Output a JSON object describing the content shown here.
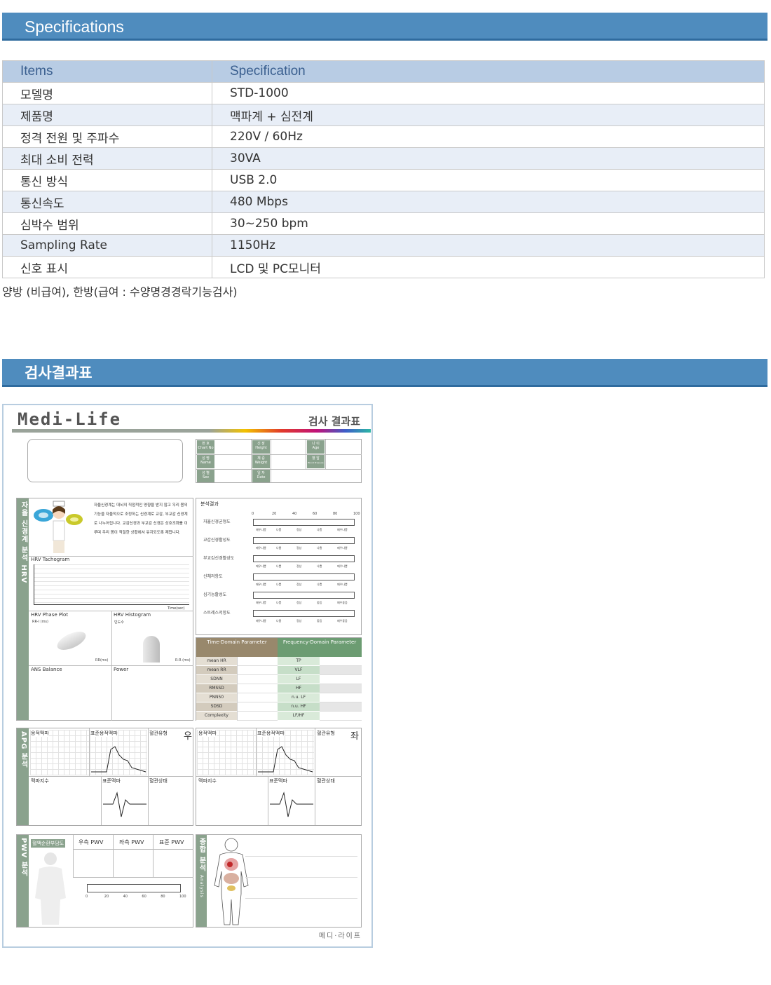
{
  "sections": {
    "specifications": "Specifications",
    "result_sheet": "검사결과표"
  },
  "spec_table": {
    "headers": [
      "Items",
      "Specification"
    ],
    "rows": [
      [
        "모델명",
        "STD-1000"
      ],
      [
        "제품명",
        "맥파계 + 심전계"
      ],
      [
        "정격 전원 및 주파수",
        "220V / 60Hz"
      ],
      [
        "최대 소비 전력",
        "30VA"
      ],
      [
        "통신 방식",
        "USB 2.0"
      ],
      [
        "통신속도",
        "480 Mbps"
      ],
      [
        "심박수 범위",
        "30~250 bpm"
      ],
      [
        "Sampling Rate",
        "1150Hz"
      ],
      [
        "신호 표시",
        "LCD 및 PC모니터"
      ]
    ],
    "note": "양방 (비급여), 한방(급여 : 수양명경경락기능검사)"
  },
  "sheet": {
    "logo": "Medi-Life",
    "title": "검사 결과표",
    "footer": "메디·라이프",
    "patient_info": [
      {
        "ko": "번 호",
        "en": "Chart No"
      },
      {
        "ko": "신 장",
        "en": "Height"
      },
      {
        "ko": "나 이",
        "en": "Age"
      },
      {
        "ko": "성 명",
        "en": "Name"
      },
      {
        "ko": "체 중",
        "en": "Weight"
      },
      {
        "ko": "혈 압",
        "en": "Blood Pressure"
      },
      {
        "ko": "성 별",
        "en": "Sex"
      },
      {
        "ko": "일 자",
        "en": "Date"
      }
    ],
    "hrv": {
      "side_label": "자율 신경계 분석 HRV",
      "desc": "자율신경계는 대뇌의 직접적인 영향을 받지 않고 우리 몸의 기능을 자율적으로 조정하는 신경계로 교감, 부교감 신경계로 나누어집니다. 교감신경과 부교감 신경은 상호조화를 이루며 우리 몸이 적절한 상황에서 유지되도록 제합니다.",
      "tachogram": "HRV Tachogram",
      "time_axis": "Time(sec)",
      "phase_plot": "HRV Phase Plot",
      "phase_y": "RR-I (ms)",
      "phase_x": "RR(ms)",
      "histogram": "HRV Histogram",
      "hist_y": "빈도수",
      "hist_x": "R-R (ms)",
      "ans": "ANS Balance",
      "power": "Power"
    },
    "analysis": {
      "title": "분석결과",
      "scale": [
        "0",
        "20",
        "40",
        "60",
        "80",
        "100"
      ],
      "items": [
        {
          "label": "자율신경균형도",
          "levels": [
            "매우나쁨",
            "나쁨",
            "정상",
            "나쁨",
            "매우나쁨"
          ]
        },
        {
          "label": "교감신경활성도",
          "levels": [
            "매우나쁨",
            "나쁨",
            "정상",
            "나쁨",
            "매우나쁨"
          ]
        },
        {
          "label": "부교감신경활성도",
          "levels": [
            "매우나쁨",
            "나쁨",
            "정상",
            "나쁨",
            "매우나쁨"
          ]
        },
        {
          "label": "신체저항도",
          "levels": [
            "매우나쁨",
            "나쁨",
            "정상",
            "나쁨",
            "매우나쁨"
          ]
        },
        {
          "label": "심기능활성도",
          "levels": [
            "매우나쁨",
            "나쁨",
            "정상",
            "좋음",
            "매우좋음"
          ]
        },
        {
          "label": "스트레스저항도",
          "levels": [
            "매우나쁨",
            "나쁨",
            "정상",
            "좋음",
            "매우좋음"
          ]
        }
      ]
    },
    "params": {
      "time_header": "Time-Domain Parameter",
      "freq_header": "Frequency-Domain Parameter",
      "time": [
        "mean HR",
        "mean RR",
        "SDNN",
        "RMSSD",
        "PNN50",
        "SDSD",
        "Complexity"
      ],
      "freq": [
        "TP",
        "VLF",
        "LF",
        "HF",
        "n.u. LF",
        "n.u. HF",
        "LF/HF"
      ]
    },
    "apg": {
      "side_label": "APG 분석",
      "right": "우",
      "left": "좌",
      "vol_pulse": "용적맥파",
      "std_vol_pulse": "표준용적맥파",
      "vessel_type": "혈관유형",
      "pulse_index": "맥파지수",
      "std_pulse": "표준맥파",
      "vessel_state": "혈관상태"
    },
    "pwv": {
      "side_label": "PWV 분석",
      "headers": [
        "혈액순환부담도",
        "우측 PWV",
        "좌측 PWV",
        "표준 PWV"
      ],
      "scale": [
        "0",
        "20",
        "40",
        "60",
        "80",
        "100"
      ]
    },
    "summary": {
      "side_label": "종합 분석",
      "side_en": "Analysis"
    }
  }
}
